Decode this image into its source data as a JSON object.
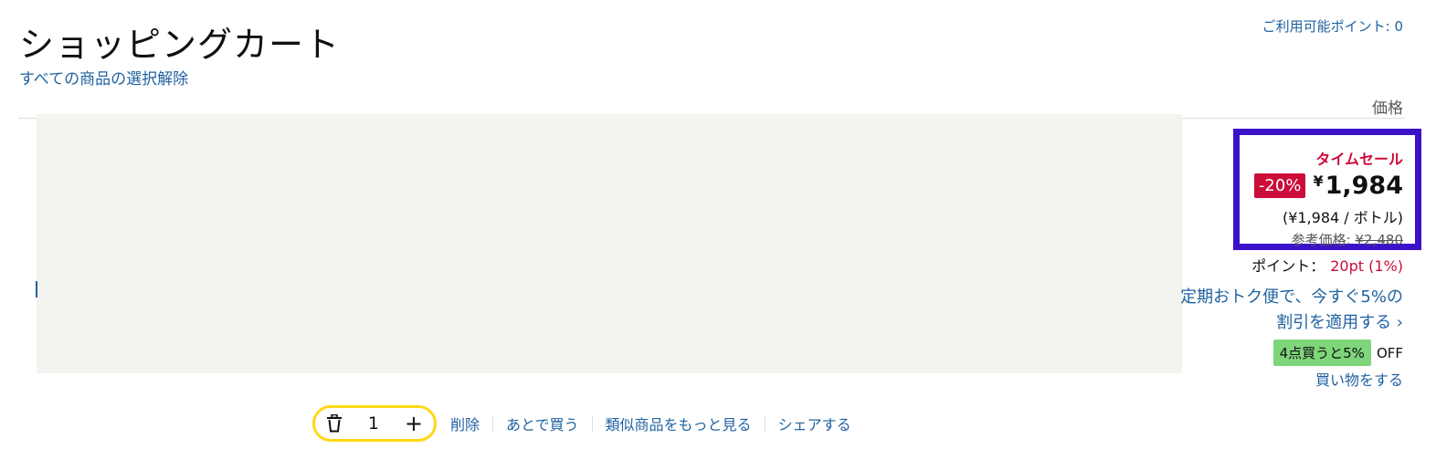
{
  "cart": {
    "title": "ショッピングカート",
    "deselect_all": "すべての商品の選択解除",
    "available_points": "ご利用可能ポイント: 0",
    "price_header": "価格"
  },
  "item": {
    "deal_label": "タイムセール",
    "discount": "-20%",
    "currency": "¥",
    "price": "1,984",
    "unit_price": "(¥1,984 / ボトル)",
    "list_price_label": "参考価格:",
    "list_price": "¥2,480",
    "points_label": "ポイント：",
    "points_value": "20pt (1%)",
    "subscribe_link": "定期おトク便で、今すぐ5%の割引を適用する ›",
    "bulk_badge": "4点買うと5%",
    "bulk_suffix": "OFF",
    "shop_link": "買い物をする",
    "quantity": "1",
    "plus_symbol": "+"
  },
  "actions": {
    "delete": "削除",
    "save_for_later": "あとで買う",
    "see_similar": "類似商品をもっと見る",
    "share": "シェアする"
  },
  "colors": {
    "link": "#2162a1",
    "deal_red": "#cc0c39",
    "highlight_box": "#3b12c9",
    "qty_border": "#ffd814",
    "bulk_badge": "#7fd57a"
  }
}
